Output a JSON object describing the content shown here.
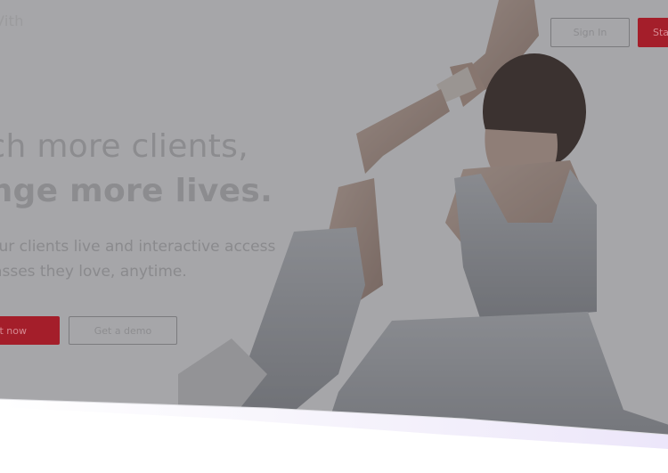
{
  "header": {
    "logo_text": "Vith",
    "sign_in_label": "Sign In",
    "start_label": "Sta"
  },
  "hero": {
    "headline_line1": "ach more clients,",
    "headline_line2": "ange more lives.",
    "subtext_line1": "your clients live and interactive access",
    "subtext_line2": "classes they love, anytime.",
    "primary_cta": "t now",
    "secondary_cta": "Get a demo"
  },
  "colors": {
    "accent": "#a41e2a",
    "overlay": "#3c3c40"
  }
}
